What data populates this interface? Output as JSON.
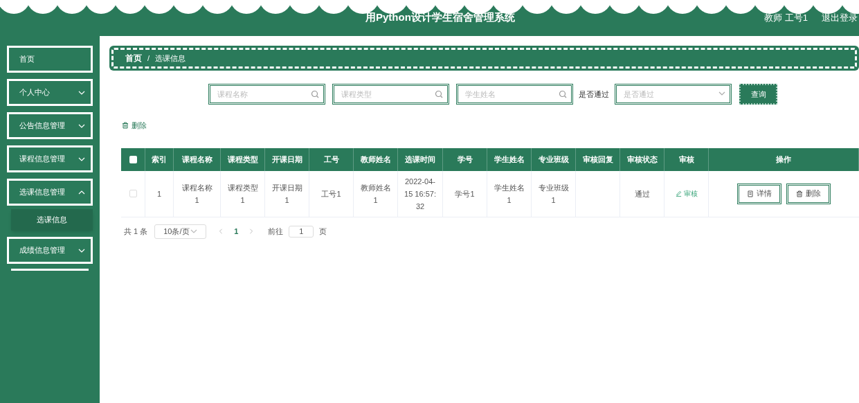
{
  "header": {
    "title": "用Python设计学生宿舍管理系统",
    "user": "教师 工号1",
    "logout": "退出登录"
  },
  "sidebar": {
    "items": [
      {
        "label": "首页",
        "has_children": false
      },
      {
        "label": "个人中心",
        "has_children": true,
        "expanded": false
      },
      {
        "label": "公告信息管理",
        "has_children": true,
        "expanded": false
      },
      {
        "label": "课程信息管理",
        "has_children": true,
        "expanded": false
      },
      {
        "label": "选课信息管理",
        "has_children": true,
        "expanded": true,
        "children": [
          {
            "label": "选课信息",
            "selected": true
          }
        ]
      },
      {
        "label": "成绩信息管理",
        "has_children": true,
        "expanded": false
      }
    ]
  },
  "breadcrumb": [
    "首页",
    "选课信息"
  ],
  "breadcrumb_separator": "/",
  "filters": {
    "course_name": {
      "placeholder": "课程名称"
    },
    "course_type": {
      "placeholder": "课程类型"
    },
    "student_name": {
      "placeholder": "学生姓名"
    },
    "passed_label": "是否通过",
    "passed": {
      "placeholder": "是否通过"
    },
    "search_button": "查询"
  },
  "delete_button": "删除",
  "table": {
    "select_all_checked": false,
    "columns": [
      "索引",
      "课程名称",
      "课程类型",
      "开课日期",
      "工号",
      "教师姓名",
      "选课时间",
      "学号",
      "学生姓名",
      "专业班级",
      "审核回复",
      "审核状态",
      "审核",
      "操作"
    ],
    "rows": [
      {
        "checked": false,
        "cells": [
          "1",
          "课程名称1",
          "课程类型1",
          "开课日期1",
          "工号1",
          "教师姓名1",
          "2022-04-15 16:57:32",
          "学号1",
          "学生姓名1",
          "专业班级1",
          "",
          "通过"
        ],
        "review": "审核",
        "actions": [
          "详情",
          "删除"
        ]
      }
    ]
  },
  "pagination": {
    "total": "共 1 条",
    "page_size": "10条/页",
    "pages": [
      {
        "label": "1",
        "selected": true
      }
    ],
    "goto_label": "前往",
    "goto_value": "1",
    "page_unit": "页"
  }
}
